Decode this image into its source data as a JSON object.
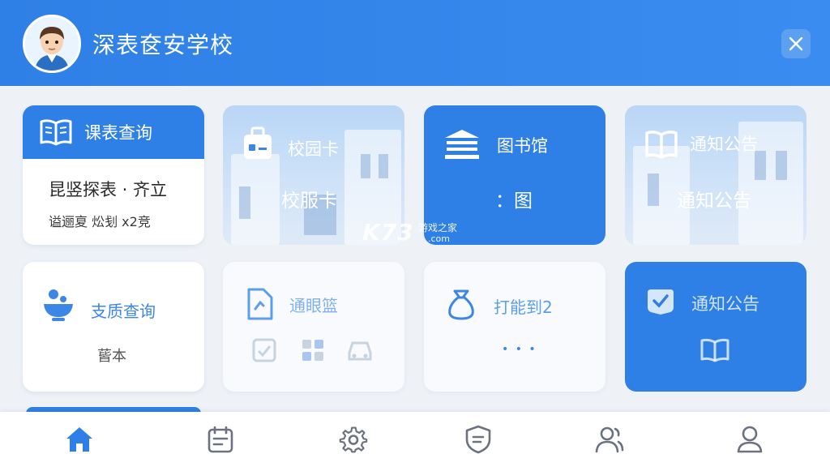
{
  "header": {
    "title": "深表奁安学校",
    "avatar_icon": "student-avatar",
    "close_icon": "close-icon"
  },
  "tiles": {
    "schedule": {
      "title": "课表查询",
      "line1": "昆竖探表 · 齐立",
      "line2": "谥逦㚆 炂刬  x2竞",
      "icon": "book-icon"
    },
    "campus_card": {
      "title": "校园卡",
      "subtitle": "校服卡",
      "icon": "id-card-icon"
    },
    "library": {
      "title": "图书馆",
      "subtitle": "：图",
      "icon": "library-icon"
    },
    "notice_top": {
      "title": "通知公告",
      "subtitle": "通知公告",
      "icon": "open-book-icon"
    },
    "quality": {
      "title": "支质查询",
      "subtitle": "蒈本",
      "icon": "bowl-icon"
    },
    "notify_small": {
      "title": "通眼篮",
      "icon": "document-icon"
    },
    "checkin": {
      "title": "打能到2",
      "subtitle": "• • •",
      "icon": "bag-icon"
    },
    "notice_bottom": {
      "title": "通知公告",
      "icon": "check-badge-icon"
    }
  },
  "watermark": {
    "brand": "K73",
    "site": "游戏之家",
    "domain": ".com"
  },
  "bottom_nav": [
    {
      "name": "home",
      "icon": "home-icon",
      "active": true
    },
    {
      "name": "calendar",
      "icon": "calendar-icon",
      "active": false
    },
    {
      "name": "settings",
      "icon": "gear-icon",
      "active": false
    },
    {
      "name": "security",
      "icon": "shield-icon",
      "active": false
    },
    {
      "name": "contacts",
      "icon": "users-icon",
      "active": false
    },
    {
      "name": "profile",
      "icon": "user-icon",
      "active": false
    }
  ],
  "colors": {
    "primary": "#2f80e6",
    "background": "#eef2f7",
    "faint_text": "#7fb0ef"
  }
}
